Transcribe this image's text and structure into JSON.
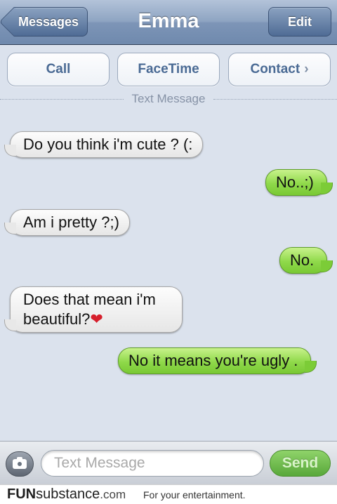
{
  "header": {
    "title": "Emma",
    "back_label": "Messages",
    "edit_label": "Edit"
  },
  "actions": {
    "call": "Call",
    "facetime": "FaceTime",
    "contact": "Contact"
  },
  "divider": "Text Message",
  "messages": [
    {
      "side": "in",
      "text": "Do you think i'm cute ? (:"
    },
    {
      "side": "out",
      "text": "No..;)"
    },
    {
      "side": "in",
      "text": "Am i pretty ?;)"
    },
    {
      "side": "out",
      "text": "No."
    },
    {
      "side": "in",
      "line1": "Does that mean i'm",
      "line2": "beautiful?",
      "emoji": "heart"
    },
    {
      "side": "out",
      "text": "No it means you're ugly ."
    }
  ],
  "composer": {
    "placeholder": "Text Message",
    "send_label": "Send"
  },
  "footer": {
    "brand_fun": "FUN",
    "brand_rest": "substance",
    "brand_tld": ".com",
    "tagline": "For your entertainment."
  },
  "colors": {
    "incoming_bubble": "#e9e9e9",
    "outgoing_bubble": "#8fd94a",
    "navbar": "#7d95b7",
    "background": "#dbe2ed"
  },
  "icons": [
    "chevron-right-icon",
    "camera-icon",
    "heart-icon"
  ]
}
